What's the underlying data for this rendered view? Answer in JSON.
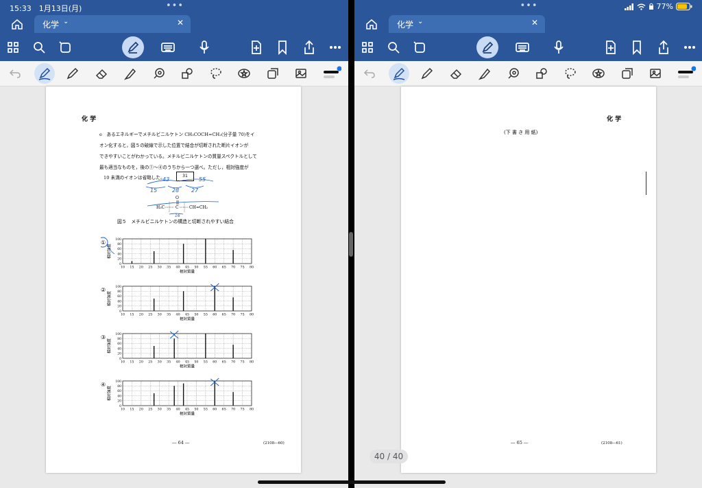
{
  "status": {
    "time": "15:33",
    "date": "1月13日(月)",
    "battery": "77%"
  },
  "left": {
    "tab_label": "化学",
    "header_subject": "化 学",
    "question_lines": [
      "e　あるエネルギーでメチルビニルケトン CH₃COCH=CH₂(分子量 70)をイ",
      "オン化すると，図５の破線で示した位置で結合が切断された断片イオンが",
      "できやすいことがわかっている。メチルビニルケトンの質量スペクトルとして",
      "最も適当なものを，後の①～④のうちから一つ選べ。ただし，相対強度が",
      "10 未満のイオンは省略した。"
    ],
    "answer_box": "31",
    "structure": {
      "o": "O",
      "left": "H₃C",
      "c": "C",
      "right": "CH=CH₂"
    },
    "handwriting": {
      "n43": "43",
      "n55": "55",
      "n15": "15",
      "n28": "28",
      "n27": "27",
      "n16": "16"
    },
    "figure_caption": "図５　メチルビニルケトンの構造と切断されやすい結合",
    "footer_page": "― 64 ―",
    "footer_code": "(2108―60)"
  },
  "right": {
    "tab_label": "化学",
    "header_subject": "化 学",
    "scratch_label": "(下 書 き 用 紙)",
    "footer_page": "― 65 ―",
    "footer_code": "(2108―61)",
    "page_counter": "40 / 40"
  },
  "chart_data": [
    {
      "type": "bar",
      "choice": "①",
      "xlabel": "相対質量",
      "ylabel": "相対強度",
      "xlim": [
        10,
        80
      ],
      "ylim": [
        0,
        100
      ],
      "xticks": [
        10,
        15,
        20,
        25,
        30,
        35,
        40,
        45,
        50,
        55,
        60,
        65,
        70,
        75,
        80
      ],
      "yticks": [
        0,
        20,
        40,
        60,
        80,
        100
      ],
      "x": [
        15,
        27,
        43,
        55,
        70
      ],
      "values": [
        10,
        50,
        80,
        100,
        55
      ]
    },
    {
      "type": "bar",
      "choice": "②",
      "xlabel": "相対質量",
      "ylabel": "相対強度",
      "xlim": [
        10,
        80
      ],
      "ylim": [
        0,
        100
      ],
      "xticks": [
        10,
        15,
        20,
        25,
        30,
        35,
        40,
        45,
        50,
        55,
        60,
        65,
        70,
        75,
        80
      ],
      "yticks": [
        0,
        20,
        40,
        60,
        80,
        100
      ],
      "x": [
        27,
        43,
        60,
        70
      ],
      "values": [
        50,
        80,
        100,
        55
      ]
    },
    {
      "type": "bar",
      "choice": "③",
      "xlabel": "相対質量",
      "ylabel": "相対強度",
      "xlim": [
        10,
        80
      ],
      "ylim": [
        0,
        100
      ],
      "xticks": [
        10,
        15,
        20,
        25,
        30,
        35,
        40,
        45,
        50,
        55,
        60,
        65,
        70,
        75,
        80
      ],
      "yticks": [
        0,
        20,
        40,
        60,
        80,
        100
      ],
      "x": [
        27,
        38,
        55,
        70
      ],
      "values": [
        50,
        80,
        100,
        55
      ]
    },
    {
      "type": "bar",
      "choice": "④",
      "xlabel": "相対質量",
      "ylabel": "相対強度",
      "xlim": [
        10,
        80
      ],
      "ylim": [
        0,
        100
      ],
      "xticks": [
        10,
        15,
        20,
        25,
        30,
        35,
        40,
        45,
        50,
        55,
        60,
        65,
        70,
        75,
        80
      ],
      "yticks": [
        0,
        20,
        40,
        60,
        80,
        100
      ],
      "x": [
        27,
        38,
        43,
        60,
        70
      ],
      "values": [
        50,
        80,
        90,
        100,
        55
      ]
    }
  ]
}
